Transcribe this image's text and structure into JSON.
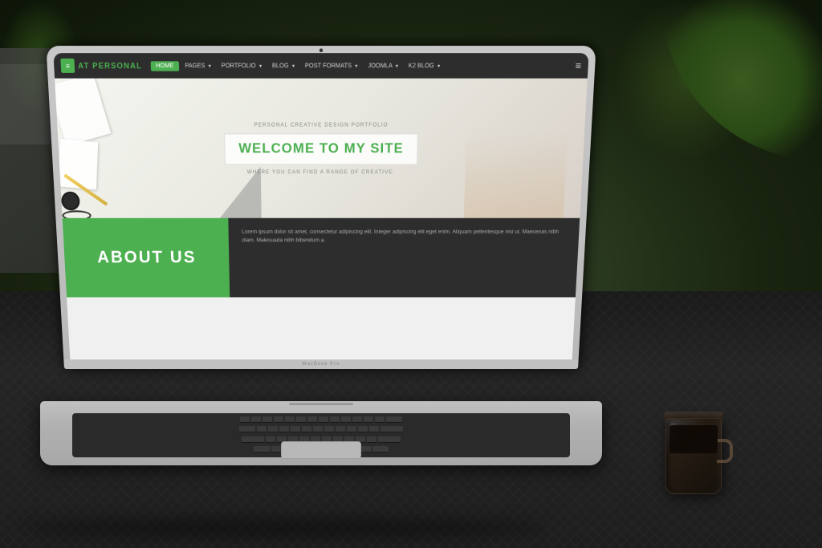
{
  "scene": {
    "title": "MacBook Pro with website screenshot"
  },
  "laptop": {
    "model_label": "MacBook Pro",
    "camera_label": "camera"
  },
  "website": {
    "navbar": {
      "logo_icon": "grid-icon",
      "logo_prefix": "AT ",
      "logo_name": "PERSONAL",
      "nav_items": [
        {
          "label": "HOME",
          "active": true
        },
        {
          "label": "PAGES",
          "has_arrow": true
        },
        {
          "label": "PORTFOLIO",
          "has_arrow": true
        },
        {
          "label": "BLOG",
          "has_arrow": true
        },
        {
          "label": "POST FORMATS",
          "has_arrow": true
        },
        {
          "label": "JOOMLA",
          "has_arrow": true
        },
        {
          "label": "K2 BLOG",
          "has_arrow": true
        }
      ]
    },
    "hero": {
      "subtitle": "PERSONAL CREATIVE DESIGN PORTFOLIO",
      "title_part1": "WELCOME TO ",
      "title_part2": "MY SITE",
      "description": "WHERE YOU CAN FIND A RANGE OF CREATIVE."
    },
    "about": {
      "heading": "ABOUT US",
      "body_text": "Lorem ipsum dolor sit amet, consectetur adipiscing elit. Integer adipiscing elit eget enim. Aliquam pellentesque nisi ut. Maecenas nibh diam. Malesuada nibh bibendum a."
    }
  },
  "coffee": {
    "label": "coffee glass"
  }
}
